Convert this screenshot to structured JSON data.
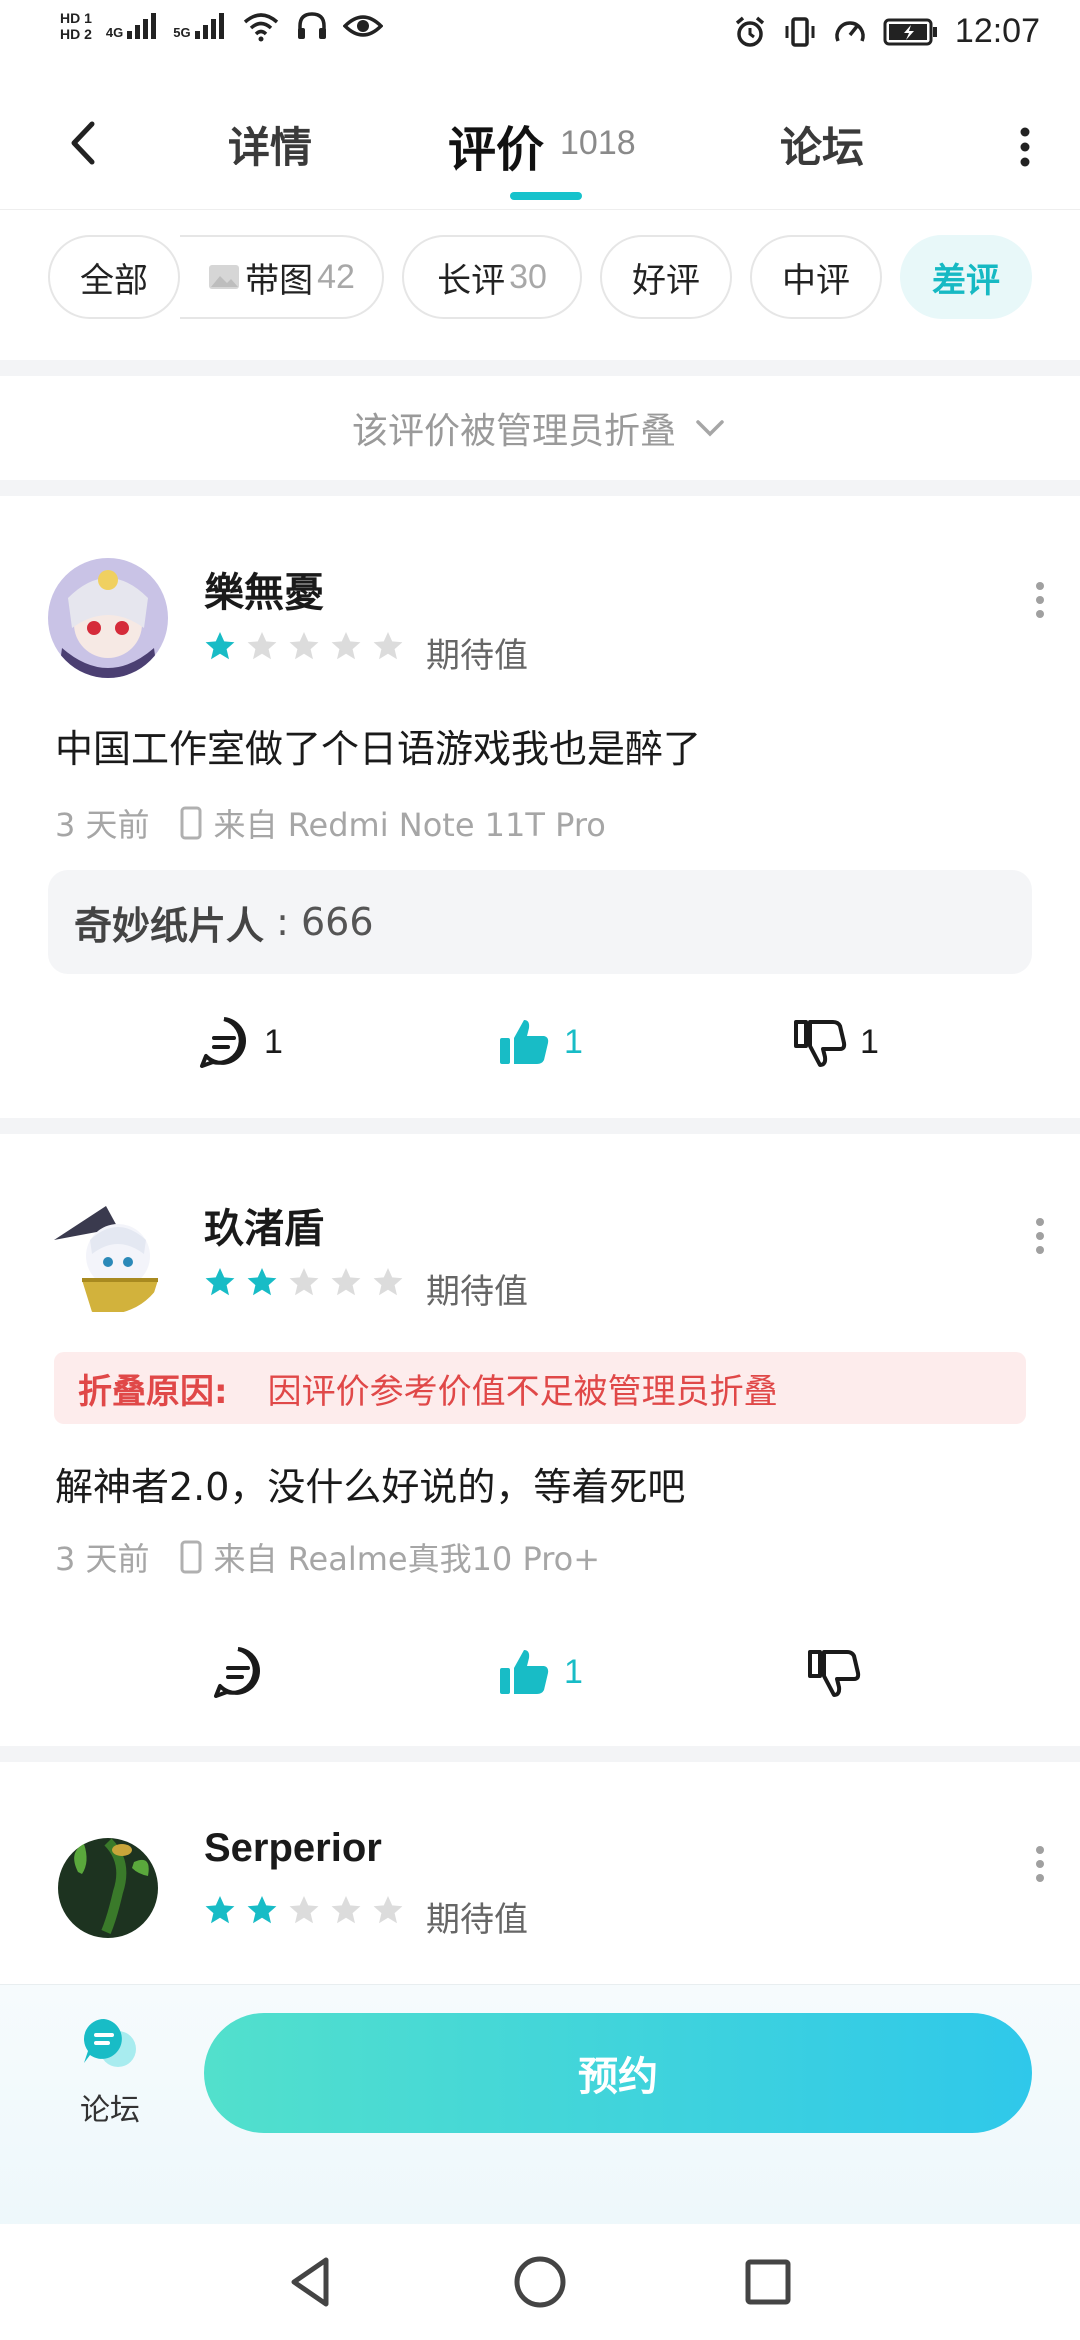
{
  "status_bar": {
    "hd1": "HD 1",
    "hd2": "HD 2",
    "net1": "4G",
    "net2": "5G",
    "time": "12:07"
  },
  "header": {
    "tabs": [
      {
        "label": "详情"
      },
      {
        "label": "评价",
        "count": "1018"
      },
      {
        "label": "论坛"
      }
    ]
  },
  "filters": [
    {
      "label": "全部"
    },
    {
      "label": "带图",
      "count": "42"
    },
    {
      "label": "长评",
      "count": "30"
    },
    {
      "label": "好评"
    },
    {
      "label": "中评"
    },
    {
      "label": "差评"
    }
  ],
  "folded_notice": "该评价被管理员折叠",
  "reviews": [
    {
      "user": "樂無憂",
      "rating": 1,
      "rating_label": "期待值",
      "content": "中国工作室做了个日语游戏我也是醉了",
      "time": "3 天前",
      "device": "来自 Redmi Note 11T Pro",
      "reply_user": "奇妙纸片人",
      "reply_sep": " : ",
      "reply_text": "666",
      "comments": "1",
      "likes": "1",
      "dislikes": "1"
    },
    {
      "user": "玖渚盾",
      "rating": 2,
      "rating_label": "期待值",
      "fold_reason_label": "折叠原因:",
      "fold_reason": "因评价参考价值不足被管理员折叠",
      "content": "解神者2.0，没什么好说的，等着死吧",
      "time": "3 天前",
      "device": "来自 Realme真我10 Pro+",
      "likes": "1"
    },
    {
      "user": "Serperior",
      "rating": 2,
      "rating_label": "期待值"
    }
  ],
  "bottom": {
    "forum_label": "论坛",
    "reserve_label": "预约"
  },
  "colors": {
    "accent": "#16c2cc",
    "star_on": "#18bcc6",
    "star_off": "#dcdcdc",
    "fold_red": "#e04848"
  }
}
